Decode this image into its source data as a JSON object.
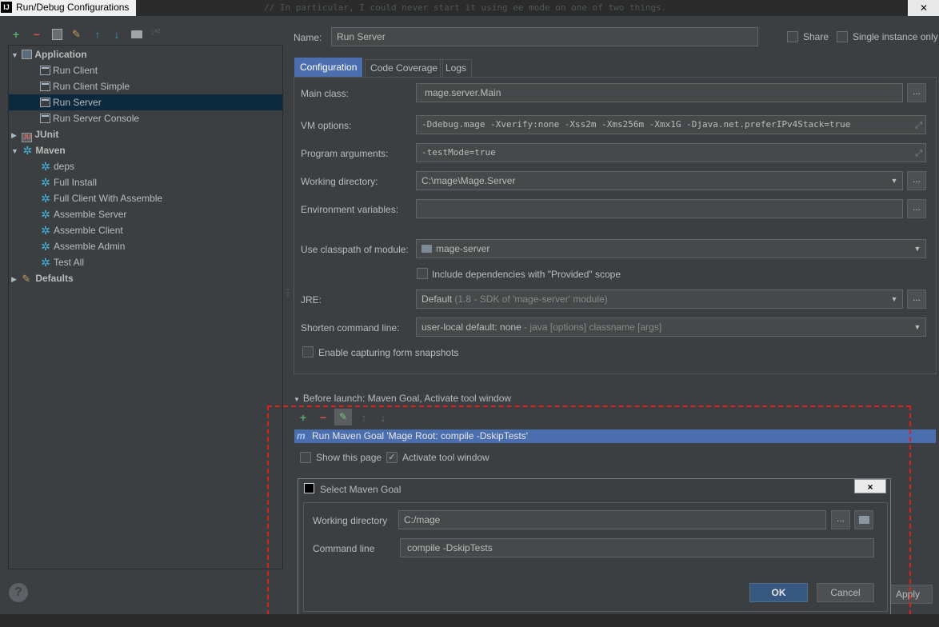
{
  "window": {
    "title": "Run/Debug Configurations",
    "logo": "IJ",
    "background_code": "// In particular, I could never start it using ee mode on one of two things."
  },
  "left_toolbar": {
    "add": "+",
    "remove": "−",
    "copy_icon": "copy-icon",
    "edit_defaults_icon": "wrench-icon",
    "move_up": "↑",
    "move_down": "↓",
    "folder_icon": "folder-icon",
    "sort": "↓ᵃᶻ"
  },
  "tree": {
    "groups": [
      {
        "label": "Application",
        "expanded": true,
        "items": [
          "Run Client",
          "Run Client Simple",
          "Run Server",
          "Run Server Console"
        ]
      },
      {
        "label": "JUnit",
        "expanded": false,
        "items": []
      },
      {
        "label": "Maven",
        "expanded": true,
        "items": [
          "deps",
          "Full Install",
          "Full Client With Assemble",
          "Assemble Server",
          "Assemble Client",
          "Assemble Admin",
          "Test All"
        ]
      },
      {
        "label": "Defaults",
        "expanded": false,
        "items": []
      }
    ],
    "selected": "Run Server"
  },
  "help": "?",
  "header": {
    "name_label": "Name:",
    "name_value": "Run Server",
    "share_label": "Share",
    "single_instance_label": "Single instance only"
  },
  "tabs": [
    "Configuration",
    "Code Coverage",
    "Logs"
  ],
  "config": {
    "main_class_label": "Main class:",
    "main_class_value": "mage.server.Main",
    "vm_options_label": "VM options:",
    "vm_options_value": "-Ddebug.mage -Xverify:none -Xss2m -Xms256m -Xmx1G -Djava.net.preferIPv4Stack=true",
    "program_args_label": "Program arguments:",
    "program_args_value": "-testMode=true",
    "working_dir_label": "Working directory:",
    "working_dir_value": "C:\\mage\\Mage.Server",
    "env_vars_label": "Environment variables:",
    "env_vars_value": "",
    "classpath_label": "Use classpath of module:",
    "classpath_value": "mage-server",
    "include_deps_label": "Include dependencies with \"Provided\" scope",
    "jre_label": "JRE:",
    "jre_value": "Default",
    "jre_hint": "(1.8 - SDK of 'mage-server' module)",
    "shorten_label": "Shorten command line:",
    "shorten_value": "user-local default: none",
    "shorten_hint": "- java [options] classname [args]",
    "snapshots_label": "Enable capturing form snapshots",
    "dots": "..."
  },
  "before_launch": {
    "header": "Before launch: Maven Goal, Activate tool window",
    "add": "+",
    "remove": "−",
    "edit_icon": "pencil-icon",
    "up": "↑",
    "down": "↓",
    "task": "Run Maven Goal 'Mage Root: compile -DskipTests'",
    "task_icon": "m",
    "show_page_label": "Show this page",
    "activate_label": "Activate tool window",
    "activate_checked": true,
    "show_page_checked": false
  },
  "dialog": {
    "title": "Select Maven Goal",
    "working_dir_label": "Working directory",
    "working_dir_value": "C:/mage",
    "command_line_label": "Command line",
    "command_line_value": "compile -DskipTests",
    "ok": "OK",
    "cancel": "Cancel",
    "close": "×",
    "dots": "..."
  },
  "footer": {
    "apply": "Apply"
  },
  "colors": {
    "selection": "#0d293e",
    "accent": "#4b6eaf",
    "highlight_border": "#e0201c",
    "add_green": "#59a869",
    "remove_red": "#d9534f",
    "arrow_blue": "#3592c4"
  }
}
